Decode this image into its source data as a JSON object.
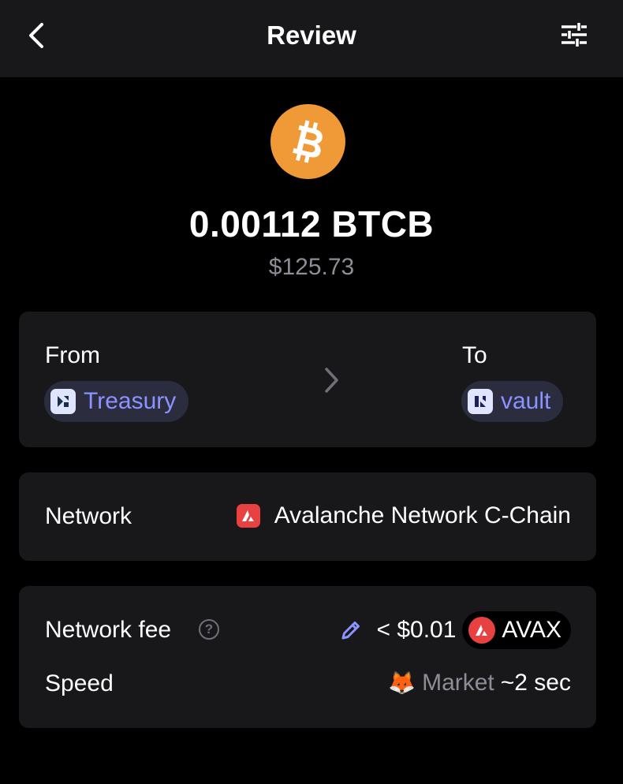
{
  "header": {
    "title": "Review",
    "back_icon": "chevron-left-icon",
    "settings_icon": "sliders-icon"
  },
  "asset": {
    "icon": "bitcoin-icon",
    "amount": "0.00112 BTCB",
    "fiat_value": "$125.73",
    "icon_color": "#f09a37"
  },
  "transfer": {
    "from_label": "From",
    "to_label": "To",
    "from_name": "Treasury",
    "to_name": "vault",
    "arrow_icon": "chevron-right-icon"
  },
  "network": {
    "label": "Network",
    "value": "Avalanche Network C-Chain",
    "icon": "avalanche-icon",
    "icon_color": "#e84142"
  },
  "fee": {
    "label": "Network fee",
    "help_icon": "question-circle-icon",
    "help_glyph": "?",
    "edit_icon": "pencil-icon",
    "value": "< $0.01",
    "token": "AVAX"
  },
  "speed": {
    "label": "Speed",
    "icon": "fox-icon",
    "mode": "Market",
    "duration": "~2 sec"
  },
  "colors": {
    "background": "#000000",
    "card": "#18181b",
    "accent": "#8c92ff",
    "muted": "#8d8d96"
  }
}
